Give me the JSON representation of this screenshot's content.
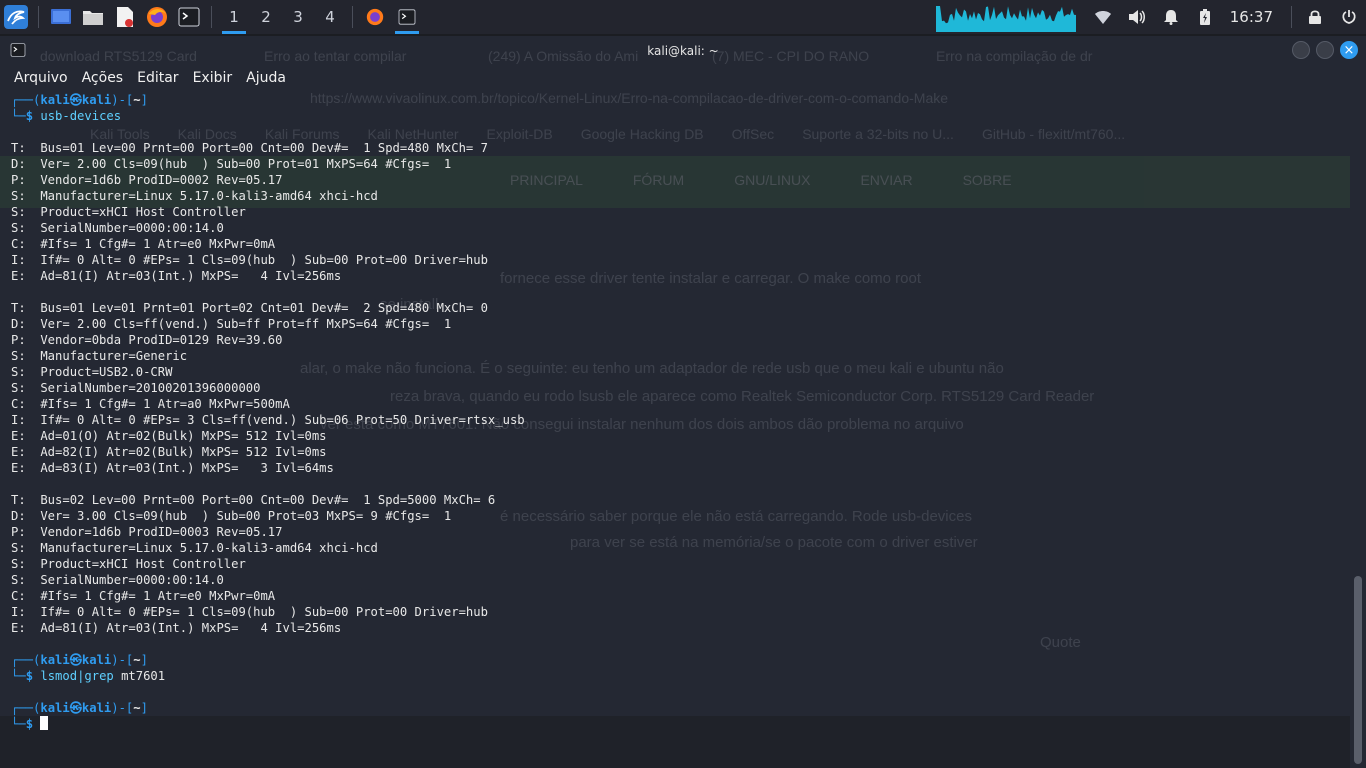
{
  "taskbar": {
    "workspaces": [
      "1",
      "2",
      "3",
      "4"
    ],
    "active_workspace": "1",
    "clock": "16:37"
  },
  "window": {
    "title": "kali@kali: ~",
    "menu": [
      "Arquivo",
      "Ações",
      "Editar",
      "Exibir",
      "Ajuda"
    ]
  },
  "background_browser": {
    "tabs": [
      "download RTS5129 Card",
      "Erro ao tentar compilar",
      "(249) A Omissão do Ami",
      "(7) MEC - CPI DO RANO",
      "Erro na compilação de dr"
    ],
    "url": "https://www.vivaolinux.com.br/topico/Kernel-Linux/Erro-na-compilacao-de-driver-com-o-comando-Make",
    "bookmarks": [
      "Kali Tools",
      "Kali Docs",
      "Kali Forums",
      "Kali NetHunter",
      "Exploit-DB",
      "Google Hacking DB",
      "OffSec",
      "Suporte a 32-bits no U...",
      "GitHub - flexitt/mt760..."
    ],
    "nav": [
      "PRINCIPAL",
      "FÓRUM",
      "GNU/LINUX",
      "ENVIAR",
      "SOBRE"
    ],
    "paragraphs": [
      "fornece esse driver tente instalar e carregar. O make como root",
      "se install",
      "alar, o make não funciona. É o seguinte: eu tenho um adaptador de rede usb que o meu kali e ubuntu não",
      "reza brava, quando eu rodo lsusb ele aparece como Realtek Semiconductor Corp. RTS5129 Card Reader",
      "ver está como MT7601. Não consegui instalar nenhum dos dois ambos dão problema no arquivo",
      "é necessário saber porque ele não está carregando. Rode usb-devices",
      "para ver se está na memória/se o pacote com o driver estiver",
      "Quote"
    ]
  },
  "terminal": {
    "user": "kali",
    "host": "kali",
    "cwd": "~",
    "commands": [
      {
        "cmd": "usb-devices",
        "args": ""
      },
      {
        "cmd": "lsmod",
        "args": "|grep mt7601"
      }
    ],
    "output_blocks": [
      [
        "T:  Bus=01 Lev=00 Prnt=00 Port=00 Cnt=00 Dev#=  1 Spd=480 MxCh= 7",
        "D:  Ver= 2.00 Cls=09(hub  ) Sub=00 Prot=01 MxPS=64 #Cfgs=  1",
        "P:  Vendor=1d6b ProdID=0002 Rev=05.17",
        "S:  Manufacturer=Linux 5.17.0-kali3-amd64 xhci-hcd",
        "S:  Product=xHCI Host Controller",
        "S:  SerialNumber=0000:00:14.0",
        "C:  #Ifs= 1 Cfg#= 1 Atr=e0 MxPwr=0mA",
        "I:  If#= 0 Alt= 0 #EPs= 1 Cls=09(hub  ) Sub=00 Prot=00 Driver=hub",
        "E:  Ad=81(I) Atr=03(Int.) MxPS=   4 Ivl=256ms"
      ],
      [
        "T:  Bus=01 Lev=01 Prnt=01 Port=02 Cnt=01 Dev#=  2 Spd=480 MxCh= 0",
        "D:  Ver= 2.00 Cls=ff(vend.) Sub=ff Prot=ff MxPS=64 #Cfgs=  1",
        "P:  Vendor=0bda ProdID=0129 Rev=39.60",
        "S:  Manufacturer=Generic",
        "S:  Product=USB2.0-CRW",
        "S:  SerialNumber=20100201396000000",
        "C:  #Ifs= 1 Cfg#= 1 Atr=a0 MxPwr=500mA",
        "I:  If#= 0 Alt= 0 #EPs= 3 Cls=ff(vend.) Sub=06 Prot=50 Driver=rtsx_usb",
        "E:  Ad=01(O) Atr=02(Bulk) MxPS= 512 Ivl=0ms",
        "E:  Ad=82(I) Atr=02(Bulk) MxPS= 512 Ivl=0ms",
        "E:  Ad=83(I) Atr=03(Int.) MxPS=   3 Ivl=64ms"
      ],
      [
        "T:  Bus=02 Lev=00 Prnt=00 Port=00 Cnt=00 Dev#=  1 Spd=5000 MxCh= 6",
        "D:  Ver= 3.00 Cls=09(hub  ) Sub=00 Prot=03 MxPS= 9 #Cfgs=  1",
        "P:  Vendor=1d6b ProdID=0003 Rev=05.17",
        "S:  Manufacturer=Linux 5.17.0-kali3-amd64 xhci-hcd",
        "S:  Product=xHCI Host Controller",
        "S:  SerialNumber=0000:00:14.0",
        "C:  #Ifs= 1 Cfg#= 1 Atr=e0 MxPwr=0mA",
        "I:  If#= 0 Alt= 0 #EPs= 1 Cls=09(hub  ) Sub=00 Prot=00 Driver=hub",
        "E:  Ad=81(I) Atr=03(Int.) MxPS=   4 Ivl=256ms"
      ]
    ]
  },
  "colors": {
    "accent": "#2f9cf0",
    "terminal_bg": "#242833",
    "panel_bg": "#23252e"
  },
  "icons": {
    "launcher": "kali-dragon-icon",
    "tray": [
      "wifi-icon",
      "volume-icon",
      "bell-icon",
      "battery-icon",
      "lock-icon",
      "power-icon"
    ]
  }
}
